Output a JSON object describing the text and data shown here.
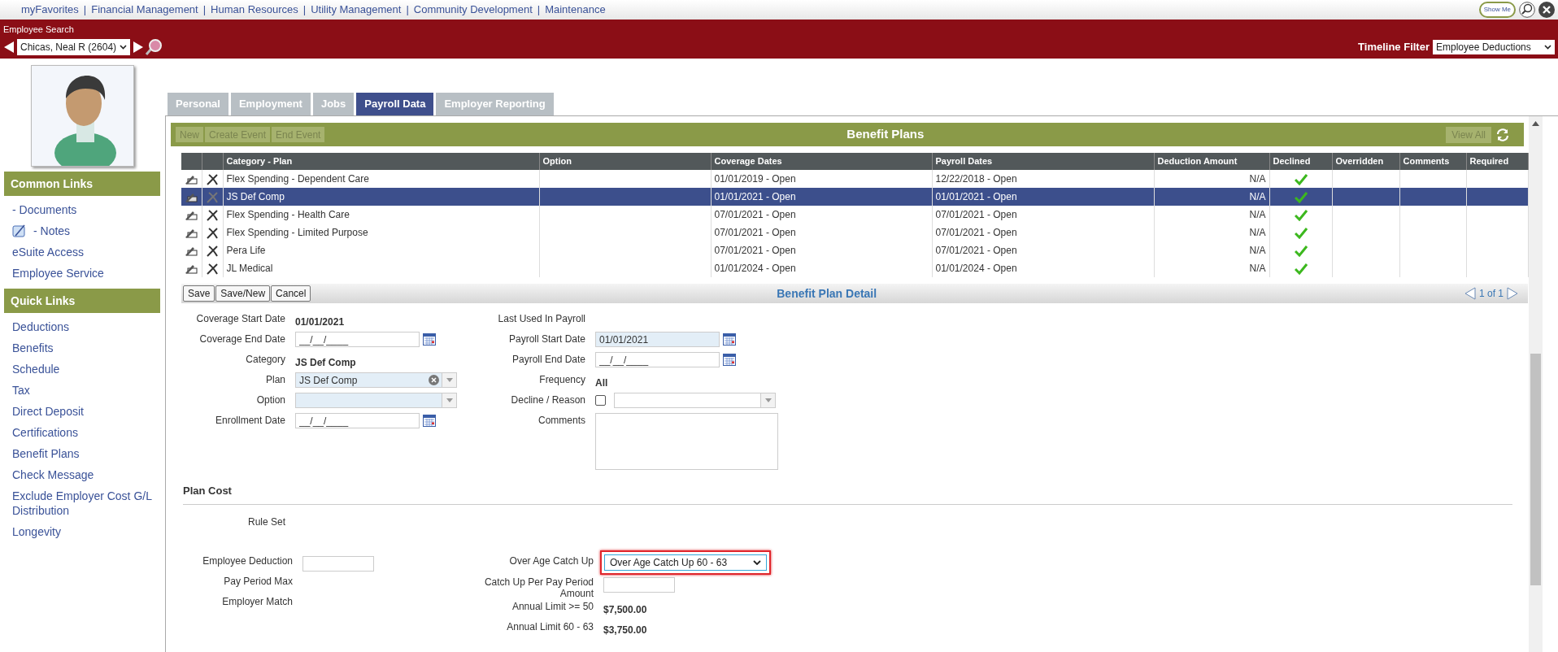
{
  "top_nav": {
    "links": [
      "myFavorites",
      "Financial Management",
      "Human Resources",
      "Utility Management",
      "Community Development",
      "Maintenance"
    ],
    "separator": "|",
    "show_me": "Show Me"
  },
  "header": {
    "title": "Employee Search",
    "employee": "Chicas, Neal R (2604)",
    "timeline_label": "Timeline Filter",
    "timeline_value": "Employee Deductions"
  },
  "sidebar": {
    "sections": [
      {
        "title": "Common Links",
        "items": [
          {
            "label": "- Documents",
            "kind": "link"
          },
          {
            "label": "- Notes",
            "kind": "icon_link"
          },
          {
            "label": "eSuite Access",
            "kind": "link"
          },
          {
            "label": "Employee Service",
            "kind": "link"
          }
        ]
      },
      {
        "title": "Quick Links",
        "items": [
          {
            "label": "Deductions",
            "kind": "link"
          },
          {
            "label": "Benefits",
            "kind": "link"
          },
          {
            "label": "Schedule",
            "kind": "link"
          },
          {
            "label": "Tax",
            "kind": "link"
          },
          {
            "label": "Direct Deposit",
            "kind": "link"
          },
          {
            "label": "Certifications",
            "kind": "link"
          },
          {
            "label": "Benefit Plans",
            "kind": "link"
          },
          {
            "label": "Check Message",
            "kind": "link"
          },
          {
            "label": "Exclude Employer Cost G/L Distribution",
            "kind": "link"
          },
          {
            "label": "Longevity",
            "kind": "link"
          }
        ]
      }
    ]
  },
  "tabs": [
    {
      "label": "Personal",
      "selected": false
    },
    {
      "label": "Employment",
      "selected": false
    },
    {
      "label": "Jobs",
      "selected": false
    },
    {
      "label": "Payroll Data",
      "selected": true
    },
    {
      "label": "Employer Reporting",
      "selected": false
    }
  ],
  "benefit_plans": {
    "title": "Benefit Plans",
    "toolbar_buttons": [
      {
        "label": "New",
        "disabled": true
      },
      {
        "label": "Create Event",
        "disabled": true
      },
      {
        "label": "End Event",
        "disabled": true
      }
    ],
    "view_all": {
      "label": "View All",
      "disabled": true
    },
    "columns": [
      "Category - Plan",
      "Option",
      "Coverage Dates",
      "Payroll Dates",
      "Deduction Amount",
      "Declined",
      "Overridden",
      "Comments",
      "Required"
    ],
    "rows": [
      {
        "plan": "Flex Spending - Dependent Care",
        "coverage_dates": "01/01/2019 - Open",
        "payroll_dates": "12/22/2018 - Open",
        "deduction_amount": "N/A",
        "declined": true,
        "selected": false
      },
      {
        "plan": "JS Def Comp",
        "coverage_dates": "01/01/2021 - Open",
        "payroll_dates": "01/01/2021 - Open",
        "deduction_amount": "N/A",
        "declined": true,
        "selected": true
      },
      {
        "plan": "Flex Spending - Health Care",
        "coverage_dates": "07/01/2021 - Open",
        "payroll_dates": "07/01/2021 - Open",
        "deduction_amount": "N/A",
        "declined": true,
        "selected": false
      },
      {
        "plan": "Flex Spending - Limited Purpose",
        "coverage_dates": "07/01/2021 - Open",
        "payroll_dates": "07/01/2021 - Open",
        "deduction_amount": "N/A",
        "declined": true,
        "selected": false
      },
      {
        "plan": "Pera Life",
        "coverage_dates": "07/01/2021 - Open",
        "payroll_dates": "07/01/2021 - Open",
        "deduction_amount": "N/A",
        "declined": true,
        "selected": false
      },
      {
        "plan": "JL Medical",
        "coverage_dates": "01/01/2024 - Open",
        "payroll_dates": "01/01/2024 - Open",
        "deduction_amount": "N/A",
        "declined": true,
        "selected": false
      }
    ]
  },
  "detail": {
    "title": "Benefit Plan Detail",
    "buttons": [
      "Save",
      "Save/New",
      "Cancel"
    ],
    "pager": "1 of 1",
    "left_fields": [
      {
        "label": "Coverage Start Date",
        "kind": "static",
        "value": "01/01/2021"
      },
      {
        "label": "Coverage End Date",
        "kind": "date",
        "value": "__/__/____",
        "disabled": false
      },
      {
        "label": "Category",
        "kind": "static",
        "value": "JS Def Comp"
      },
      {
        "label": "Plan",
        "kind": "combo",
        "value": "JS Def Comp",
        "disabled": true
      },
      {
        "label": "Option",
        "kind": "select",
        "disabled": true
      },
      {
        "label": "Enrollment Date",
        "kind": "date",
        "value": "__/__/____",
        "disabled": false
      }
    ],
    "right_fields": [
      {
        "label": "Last Used In Payroll",
        "kind": "static"
      },
      {
        "label": "Payroll Start Date",
        "kind": "date",
        "value": "01/01/2021",
        "disabled": true
      },
      {
        "label": "Payroll End Date",
        "kind": "date",
        "value": "__/__/____",
        "disabled": false
      },
      {
        "label": "Frequency",
        "kind": "static",
        "value": "All"
      },
      {
        "label": "Decline / Reason",
        "kind": "checkbox_select",
        "checked": false
      },
      {
        "label": "Comments",
        "kind": "textarea"
      }
    ]
  },
  "plan_cost": {
    "title": "Plan Cost",
    "rule_set_label": "Rule Set",
    "left_fields": [
      {
        "label": "Employee Deduction",
        "kind": "input"
      },
      {
        "label": "Pay Period Max",
        "kind": "static"
      },
      {
        "label": "Employer Match",
        "kind": "static"
      }
    ],
    "right_fields": [
      {
        "label": "Over Age Catch Up",
        "kind": "dropdown",
        "value": "Over Age Catch Up 60 - 63",
        "highlighted": true
      },
      {
        "label": "Catch Up Per Pay Period Amount",
        "kind": "input"
      },
      {
        "label": "Annual Limit >= 50",
        "kind": "static",
        "value": "$7,500.00"
      },
      {
        "label": "Annual Limit 60 - 63",
        "kind": "static",
        "value": "$3,750.00"
      }
    ]
  }
}
